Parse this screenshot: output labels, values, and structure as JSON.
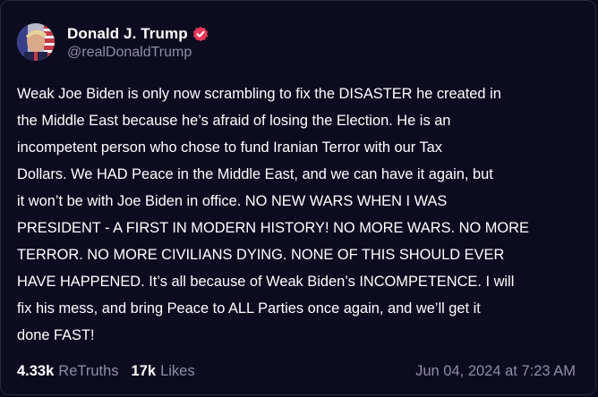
{
  "author": {
    "display_name": "Donald J. Trump",
    "handle": "@realDonaldTrump",
    "verified_icon": "verified-badge-icon",
    "verified_color": "#e8395a"
  },
  "post": {
    "text": "Weak Joe Biden is only now scrambling to fix the DISASTER he created in\nthe Middle East because he’s afraid of losing the Election. He is an\nincompetent person who chose to fund Iranian Terror with our Tax\nDollars. We HAD Peace in the Middle East, and we can have it again, but\nit won’t be with Joe Biden in office. NO NEW WARS WHEN I WAS\nPRESIDENT - A FIRST IN MODERN HISTORY! NO MORE WARS. NO MORE\nTERROR. NO MORE CIVILIANS DYING. NONE OF THIS SHOULD EVER\nHAVE HAPPENED. It’s all because of Weak Biden’s INCOMPETENCE. I will\nfix his mess, and bring Peace to ALL Parties once again, and we’ll get it\ndone FAST!"
  },
  "stats": {
    "retruths_count": "4.33k",
    "retruths_label": "ReTruths",
    "likes_count": "17k",
    "likes_label": "Likes"
  },
  "timestamp": "Jun 04, 2024 at 7:23 AM",
  "colors": {
    "background": "#0d0b20",
    "text": "#ffffff",
    "muted": "#8f8da6"
  }
}
